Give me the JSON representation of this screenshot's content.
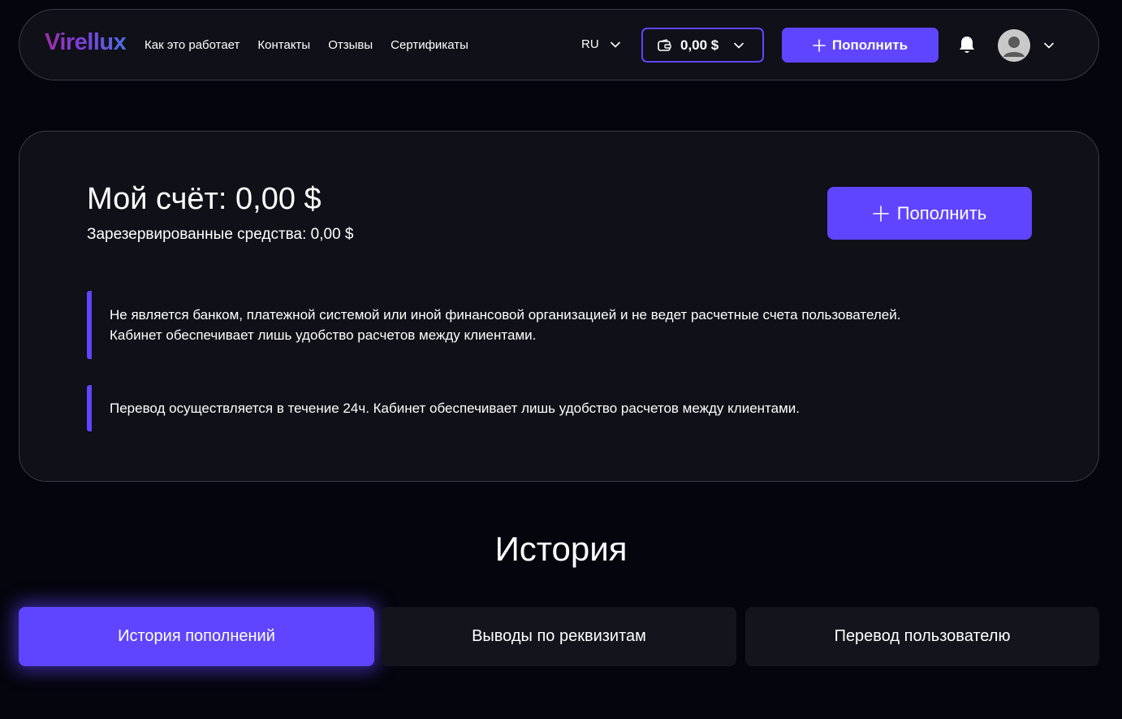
{
  "header": {
    "logo": "Virellux",
    "nav": [
      "Как это работает",
      "Контакты",
      "Отзывы",
      "Сертификаты"
    ],
    "language": "RU",
    "wallet_balance": "0,00 $",
    "topup_label": "Пополнить",
    "icons": {
      "wallet": "wallet-icon",
      "plus": "plus-icon",
      "bell": "bell-icon",
      "avatar": "user-avatar",
      "chevron": "chevron-down-icon"
    }
  },
  "account": {
    "title": "Мой счёт: 0,00 $",
    "reserved": "Зарезервированные средства: 0,00 $",
    "topup_label": "Пополнить",
    "notices": [
      {
        "line1": "Не является банком, платежной системой или иной финансовой организацией и не ведет расчетные счета пользователей.",
        "line2": "Кабинет обеспечивает лишь удобство расчетов между клиентами."
      },
      {
        "line1": "Перевод осуществляется в течение 24ч. Кабинет обеспечивает лишь удобство расчетов между клиентами."
      }
    ]
  },
  "history": {
    "title": "История",
    "tabs": [
      "История пополнений",
      "Выводы по реквизитам",
      "Перевод пользователю"
    ],
    "active_tab": "История пополнений"
  },
  "colors": {
    "background": "#05050d",
    "panel": "#101018",
    "accent": "#5f45ff",
    "border": "#3a3a4a"
  }
}
